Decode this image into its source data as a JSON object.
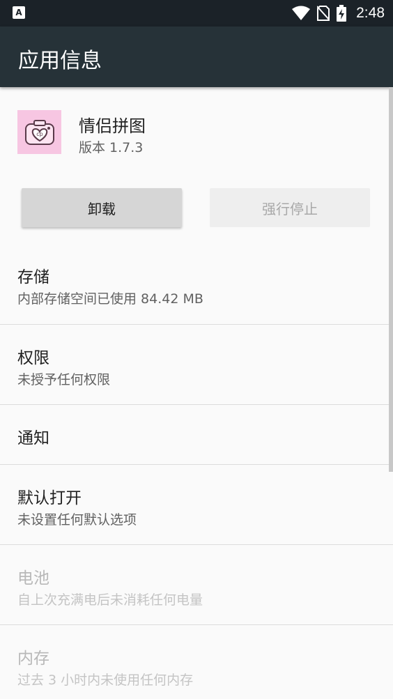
{
  "status_bar": {
    "notification_letter": "A",
    "time": "2:48",
    "icons": [
      "wifi-icon",
      "no-sim-icon",
      "battery-charging-icon"
    ]
  },
  "app_bar": {
    "title": "应用信息"
  },
  "app": {
    "name": "情侣拼图",
    "version": "版本 1.7.3",
    "icon_bg": "#f7c6e2"
  },
  "buttons": {
    "uninstall": "卸载",
    "force_stop": "强行停止"
  },
  "settings": [
    {
      "title": "存储",
      "subtitle": "内部存储空间已使用 84.42 MB",
      "enabled": true
    },
    {
      "title": "权限",
      "subtitle": "未授予任何权限",
      "enabled": true
    },
    {
      "title": "通知",
      "subtitle": "",
      "enabled": true
    },
    {
      "title": "默认打开",
      "subtitle": "未设置任何默认选项",
      "enabled": true
    },
    {
      "title": "电池",
      "subtitle": "自上次充满电后未消耗任何电量",
      "enabled": false
    },
    {
      "title": "内存",
      "subtitle": "过去 3 小时内未使用任何内存",
      "enabled": false
    }
  ]
}
